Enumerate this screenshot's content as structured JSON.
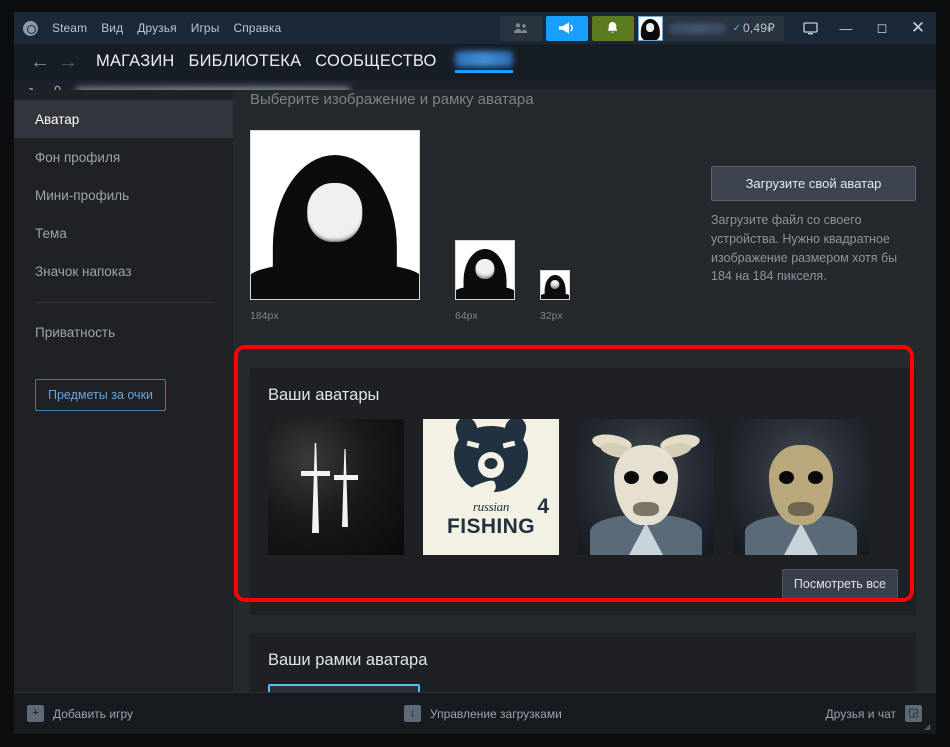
{
  "window": {
    "app_name": "Steam",
    "menus": [
      "Вид",
      "Друзья",
      "Игры",
      "Справка"
    ],
    "minimize": "—",
    "maximize": "◻",
    "close": "✕",
    "screen_icon": "🖵"
  },
  "account": {
    "balance": "0,49₽",
    "check_mark": "✓",
    "name_redacted": ""
  },
  "nav": {
    "back": "←",
    "forward": "→",
    "links": [
      "МАГАЗИН",
      "БИБЛИОТЕКА",
      "СООБЩЕСТВО"
    ],
    "user_link_redacted": ""
  },
  "urlbar": {
    "refresh_icon": "↻",
    "lock_icon": "🔒",
    "url_redacted": ""
  },
  "sidebar": {
    "items": [
      {
        "label": "Аватар",
        "active": true
      },
      {
        "label": "Фон профиля",
        "active": false
      },
      {
        "label": "Мини-профиль",
        "active": false
      },
      {
        "label": "Тема",
        "active": false
      },
      {
        "label": "Значок напоказ",
        "active": false
      }
    ],
    "items_after_sep": [
      {
        "label": "Приватность",
        "active": false
      }
    ],
    "points_button": "Предметы за очки"
  },
  "main": {
    "heading": "Выберите изображение и рамку аватара",
    "previews": [
      {
        "size_label": "184px"
      },
      {
        "size_label": "64px"
      },
      {
        "size_label": "32px"
      }
    ],
    "upload": {
      "button": "Загрузите свой аватар",
      "description": "Загрузите файл со своего устройства. Нужно квадратное изображение размером хотя бы 184 на 184 пикселя."
    },
    "avatars_panel": {
      "title": "Ваши аватары",
      "items": [
        {
          "name": "dead-by-daylight-avatar"
        },
        {
          "name": "russian-fishing-4-avatar",
          "text_top": "russian",
          "text_bottom": "FISHING",
          "number": "4"
        },
        {
          "name": "payday-horned-mask-avatar"
        },
        {
          "name": "payday-scaled-mask-avatar"
        }
      ],
      "view_all_button": "Посмотреть все"
    },
    "frames_panel": {
      "title": "Ваши рамки аватара"
    }
  },
  "statusbar": {
    "add_game": "Добавить игру",
    "downloads": "Управление загрузками",
    "friends_chat": "Друзья и чат"
  },
  "colors": {
    "highlight_red": "#ff0000",
    "accent_blue": "#1a9fff",
    "notify_green": "#5c7a1e",
    "frame_cyan": "#4fc3f7",
    "titlebar_bg": "#1b2838",
    "content_bg": "#25282d",
    "sidebar_bg": "#202124"
  }
}
